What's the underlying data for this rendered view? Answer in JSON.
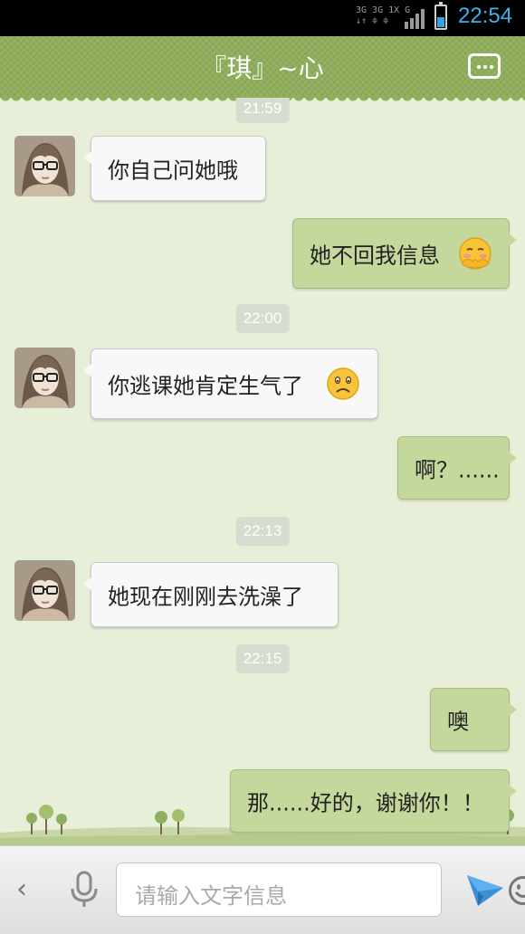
{
  "status_bar": {
    "network": [
      "3G 3G 1X G",
      "↓↑ ≑  ≑"
    ],
    "time": "22:54"
  },
  "header": {
    "title": "『琪』~心",
    "menu_icon": "more-icon"
  },
  "messages": [
    {
      "type": "timestamp",
      "text": "21:59"
    },
    {
      "type": "in",
      "text": "你自己问她哦"
    },
    {
      "type": "out",
      "text": "她不回我信息",
      "emoji": "shy-face"
    },
    {
      "type": "timestamp",
      "text": "22:00"
    },
    {
      "type": "in",
      "text": "你逃课她肯定生气了",
      "emoji": "sad-face"
    },
    {
      "type": "out",
      "text": "啊？......"
    },
    {
      "type": "timestamp",
      "text": "22:13"
    },
    {
      "type": "in",
      "text": "她现在刚刚去洗澡了"
    },
    {
      "type": "timestamp",
      "text": "22:15"
    },
    {
      "type": "out",
      "text": "噢"
    },
    {
      "type": "out",
      "text": "那......好的，谢谢你！！"
    }
  ],
  "input_bar": {
    "placeholder": "请输入文字信息"
  },
  "colors": {
    "header": "#8fad5a",
    "chat_bg": "#e8efd9",
    "out_bubble": "#c5d89c",
    "in_bubble": "#f8f8f8",
    "clock": "#3fb0e8"
  }
}
